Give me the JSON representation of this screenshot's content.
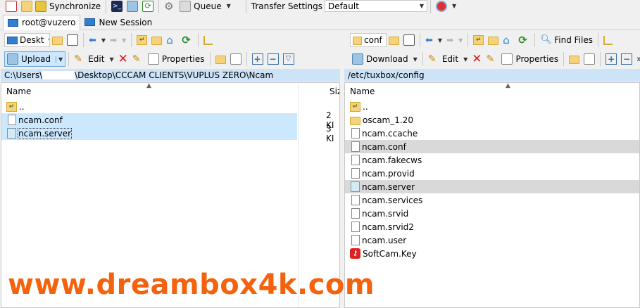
{
  "toolbar": {
    "synchronize": "Synchronize",
    "queue": "Queue",
    "transfer_settings_label": "Transfer Settings",
    "transfer_settings_value": "Default"
  },
  "tabs": [
    {
      "label": "root@vuzero",
      "active": true
    },
    {
      "label": "New Session",
      "active": false
    }
  ],
  "left": {
    "drive": "Deskt",
    "upload": "Upload",
    "edit": "Edit",
    "properties": "Properties",
    "path_prefix": "C:\\Users\\",
    "path_suffix": "\\Desktop\\CCCAM CLIENTS\\VUPLUS ZERO\\Ncam",
    "col_name": "Name",
    "col_size": "Siz",
    "files": [
      {
        "name": "..",
        "icon": "parent-folder-icon",
        "size": ""
      },
      {
        "name": "ncam.conf",
        "icon": "file-icon",
        "size": "2 KI"
      },
      {
        "name": "ncam.server",
        "icon": "server-file-icon",
        "size": "3 KI"
      }
    ]
  },
  "right": {
    "drive": "conf",
    "download": "Download",
    "edit": "Edit",
    "properties": "Properties",
    "find_files": "Find Files",
    "path": "/etc/tuxbox/config",
    "col_name": "Name",
    "files": [
      {
        "name": "..",
        "icon": "parent-folder-icon"
      },
      {
        "name": "oscam_1.20",
        "icon": "folder-icon"
      },
      {
        "name": "ncam.ccache",
        "icon": "file-icon"
      },
      {
        "name": "ncam.conf",
        "icon": "file-icon"
      },
      {
        "name": "ncam.fakecws",
        "icon": "file-icon"
      },
      {
        "name": "ncam.provid",
        "icon": "file-icon"
      },
      {
        "name": "ncam.server",
        "icon": "server-file-icon"
      },
      {
        "name": "ncam.services",
        "icon": "file-icon"
      },
      {
        "name": "ncam.srvid",
        "icon": "file-icon"
      },
      {
        "name": "ncam.srvid2",
        "icon": "file-icon"
      },
      {
        "name": "ncam.user",
        "icon": "file-icon"
      },
      {
        "name": "SoftCam.Key",
        "icon": "key-file-icon"
      }
    ]
  },
  "watermark": "www.dreambox4k.com"
}
